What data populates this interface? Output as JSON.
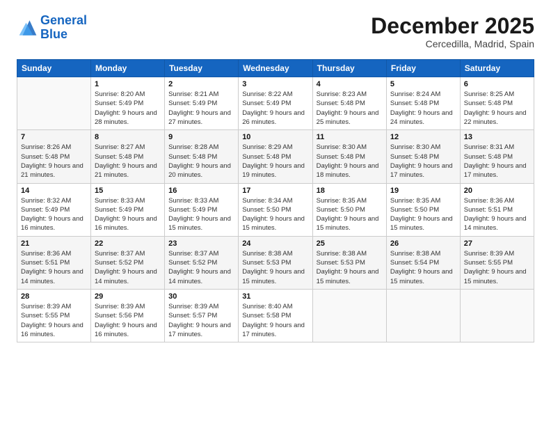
{
  "logo": {
    "line1": "General",
    "line2": "Blue"
  },
  "title": "December 2025",
  "subtitle": "Cercedilla, Madrid, Spain",
  "weekdays": [
    "Sunday",
    "Monday",
    "Tuesday",
    "Wednesday",
    "Thursday",
    "Friday",
    "Saturday"
  ],
  "weeks": [
    [
      {
        "num": "",
        "info": ""
      },
      {
        "num": "1",
        "info": "Sunrise: 8:20 AM\nSunset: 5:49 PM\nDaylight: 9 hours\nand 28 minutes."
      },
      {
        "num": "2",
        "info": "Sunrise: 8:21 AM\nSunset: 5:49 PM\nDaylight: 9 hours\nand 27 minutes."
      },
      {
        "num": "3",
        "info": "Sunrise: 8:22 AM\nSunset: 5:49 PM\nDaylight: 9 hours\nand 26 minutes."
      },
      {
        "num": "4",
        "info": "Sunrise: 8:23 AM\nSunset: 5:48 PM\nDaylight: 9 hours\nand 25 minutes."
      },
      {
        "num": "5",
        "info": "Sunrise: 8:24 AM\nSunset: 5:48 PM\nDaylight: 9 hours\nand 24 minutes."
      },
      {
        "num": "6",
        "info": "Sunrise: 8:25 AM\nSunset: 5:48 PM\nDaylight: 9 hours\nand 22 minutes."
      }
    ],
    [
      {
        "num": "7",
        "info": "Sunrise: 8:26 AM\nSunset: 5:48 PM\nDaylight: 9 hours\nand 21 minutes."
      },
      {
        "num": "8",
        "info": "Sunrise: 8:27 AM\nSunset: 5:48 PM\nDaylight: 9 hours\nand 21 minutes."
      },
      {
        "num": "9",
        "info": "Sunrise: 8:28 AM\nSunset: 5:48 PM\nDaylight: 9 hours\nand 20 minutes."
      },
      {
        "num": "10",
        "info": "Sunrise: 8:29 AM\nSunset: 5:48 PM\nDaylight: 9 hours\nand 19 minutes."
      },
      {
        "num": "11",
        "info": "Sunrise: 8:30 AM\nSunset: 5:48 PM\nDaylight: 9 hours\nand 18 minutes."
      },
      {
        "num": "12",
        "info": "Sunrise: 8:30 AM\nSunset: 5:48 PM\nDaylight: 9 hours\nand 17 minutes."
      },
      {
        "num": "13",
        "info": "Sunrise: 8:31 AM\nSunset: 5:48 PM\nDaylight: 9 hours\nand 17 minutes."
      }
    ],
    [
      {
        "num": "14",
        "info": "Sunrise: 8:32 AM\nSunset: 5:49 PM\nDaylight: 9 hours\nand 16 minutes."
      },
      {
        "num": "15",
        "info": "Sunrise: 8:33 AM\nSunset: 5:49 PM\nDaylight: 9 hours\nand 16 minutes."
      },
      {
        "num": "16",
        "info": "Sunrise: 8:33 AM\nSunset: 5:49 PM\nDaylight: 9 hours\nand 15 minutes."
      },
      {
        "num": "17",
        "info": "Sunrise: 8:34 AM\nSunset: 5:50 PM\nDaylight: 9 hours\nand 15 minutes."
      },
      {
        "num": "18",
        "info": "Sunrise: 8:35 AM\nSunset: 5:50 PM\nDaylight: 9 hours\nand 15 minutes."
      },
      {
        "num": "19",
        "info": "Sunrise: 8:35 AM\nSunset: 5:50 PM\nDaylight: 9 hours\nand 15 minutes."
      },
      {
        "num": "20",
        "info": "Sunrise: 8:36 AM\nSunset: 5:51 PM\nDaylight: 9 hours\nand 14 minutes."
      }
    ],
    [
      {
        "num": "21",
        "info": "Sunrise: 8:36 AM\nSunset: 5:51 PM\nDaylight: 9 hours\nand 14 minutes."
      },
      {
        "num": "22",
        "info": "Sunrise: 8:37 AM\nSunset: 5:52 PM\nDaylight: 9 hours\nand 14 minutes."
      },
      {
        "num": "23",
        "info": "Sunrise: 8:37 AM\nSunset: 5:52 PM\nDaylight: 9 hours\nand 14 minutes."
      },
      {
        "num": "24",
        "info": "Sunrise: 8:38 AM\nSunset: 5:53 PM\nDaylight: 9 hours\nand 15 minutes."
      },
      {
        "num": "25",
        "info": "Sunrise: 8:38 AM\nSunset: 5:53 PM\nDaylight: 9 hours\nand 15 minutes."
      },
      {
        "num": "26",
        "info": "Sunrise: 8:38 AM\nSunset: 5:54 PM\nDaylight: 9 hours\nand 15 minutes."
      },
      {
        "num": "27",
        "info": "Sunrise: 8:39 AM\nSunset: 5:55 PM\nDaylight: 9 hours\nand 15 minutes."
      }
    ],
    [
      {
        "num": "28",
        "info": "Sunrise: 8:39 AM\nSunset: 5:55 PM\nDaylight: 9 hours\nand 16 minutes."
      },
      {
        "num": "29",
        "info": "Sunrise: 8:39 AM\nSunset: 5:56 PM\nDaylight: 9 hours\nand 16 minutes."
      },
      {
        "num": "30",
        "info": "Sunrise: 8:39 AM\nSunset: 5:57 PM\nDaylight: 9 hours\nand 17 minutes."
      },
      {
        "num": "31",
        "info": "Sunrise: 8:40 AM\nSunset: 5:58 PM\nDaylight: 9 hours\nand 17 minutes."
      },
      {
        "num": "",
        "info": ""
      },
      {
        "num": "",
        "info": ""
      },
      {
        "num": "",
        "info": ""
      }
    ]
  ]
}
